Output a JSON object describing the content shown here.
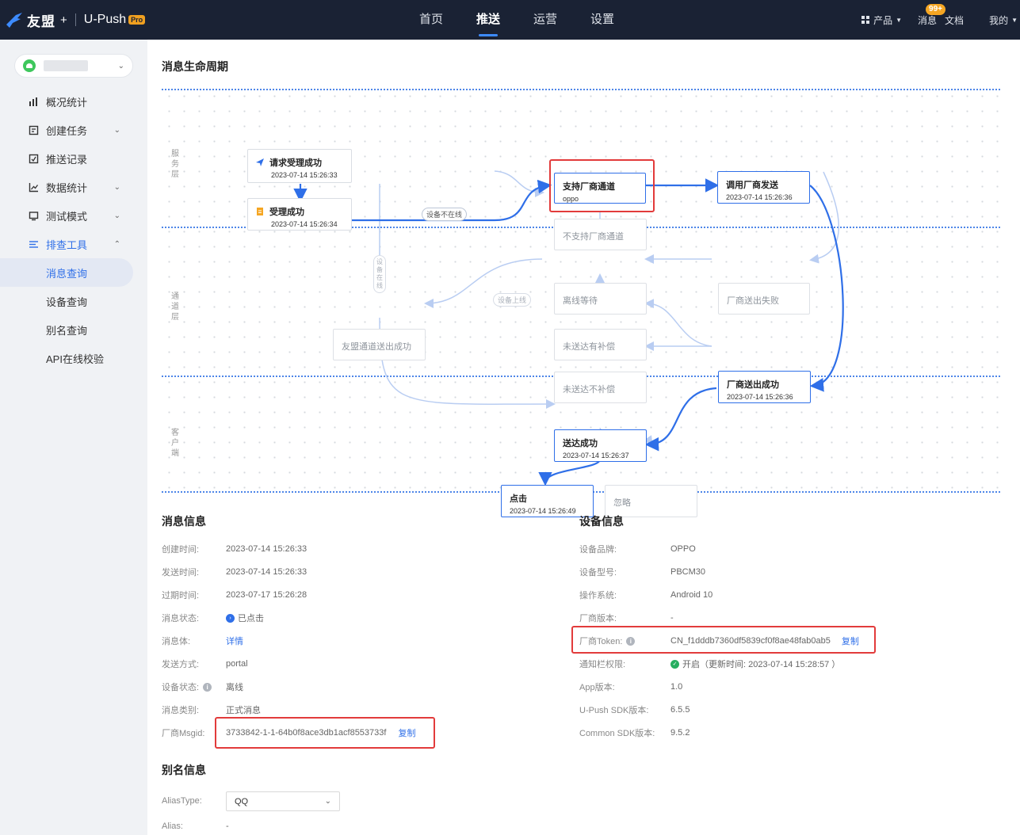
{
  "brand": {
    "name": "友盟",
    "plus": "+",
    "product": "U-Push",
    "badge": "Pro"
  },
  "nav": {
    "items": [
      "首页",
      "推送",
      "运营",
      "设置"
    ],
    "active_index": 1
  },
  "topright": {
    "products": "产品",
    "messages": "消息",
    "messages_badge": "99+",
    "docs": "文档",
    "mine": "我的"
  },
  "sidebar": {
    "menu": [
      {
        "label": "概况统计",
        "icon": "overview-icon"
      },
      {
        "label": "创建任务",
        "icon": "create-task-icon"
      },
      {
        "label": "推送记录",
        "icon": "push-record-icon"
      },
      {
        "label": "数据统计",
        "icon": "data-stats-icon"
      },
      {
        "label": "测试模式",
        "icon": "test-mode-icon"
      },
      {
        "label": "排查工具",
        "icon": "troubleshoot-icon"
      }
    ],
    "submenu": [
      "消息查询",
      "设备查询",
      "别名查询",
      "API在线校验"
    ],
    "active_sub": "消息查询"
  },
  "lifecycle": {
    "title": "消息生命周期",
    "layers": {
      "service": "服务层",
      "channel": "通道层",
      "client": "客户端"
    },
    "nodes": {
      "request_ok": {
        "title": "请求受理成功",
        "time": "2023-07-14 15:26:33"
      },
      "accept_ok": {
        "title": "受理成功",
        "time": "2023-07-14 15:26:34"
      },
      "vendor_support": {
        "title": "支持厂商通道",
        "sub": "oppo"
      },
      "vendor_call": {
        "title": "调用厂商发送",
        "time": "2023-07-14 15:26:36"
      },
      "vendor_unsupported": {
        "title": "不支持厂商通道"
      },
      "offline_wait": {
        "title": "离线等待"
      },
      "vendor_fail": {
        "title": "厂商送出失败"
      },
      "umeng_sent": {
        "title": "友盟通道送出成功"
      },
      "undelivered_comp": {
        "title": "未送达有补偿"
      },
      "undelivered_nocomp": {
        "title": "未送达不补偿"
      },
      "vendor_sent": {
        "title": "厂商送出成功",
        "time": "2023-07-14 15:26:36"
      },
      "delivered": {
        "title": "送达成功",
        "time": "2023-07-14 15:26:37"
      },
      "clicked": {
        "title": "点击",
        "time": "2023-07-14 15:26:49"
      },
      "ignored": {
        "title": "忽略"
      }
    },
    "edge_labels": {
      "device_offline": "设备不在线",
      "device_online": "设备在线",
      "device_online_up": "设备上线"
    }
  },
  "message_info": {
    "title": "消息信息",
    "rows": {
      "create_time": {
        "label": "创建时间:",
        "value": "2023-07-14 15:26:33"
      },
      "send_time": {
        "label": "发送时间:",
        "value": "2023-07-14 15:26:33"
      },
      "expire_time": {
        "label": "过期时间:",
        "value": "2023-07-17 15:26:28"
      },
      "status": {
        "label": "消息状态:",
        "value": "已点击"
      },
      "body": {
        "label": "消息体:",
        "value": "详情"
      },
      "method": {
        "label": "发送方式:",
        "value": "portal"
      },
      "device_status": {
        "label": "设备状态:",
        "value": "离线"
      },
      "category": {
        "label": "消息类别:",
        "value": "正式消息"
      },
      "msgid": {
        "label": "厂商Msgid:",
        "value": "3733842-1-1-64b0f8ace3db1acf8553733f",
        "action": "复制"
      }
    }
  },
  "device_info": {
    "title": "设备信息",
    "rows": {
      "brand": {
        "label": "设备品牌:",
        "value": "OPPO"
      },
      "model": {
        "label": "设备型号:",
        "value": "PBCM30"
      },
      "os": {
        "label": "操作系统:",
        "value": "Android 10"
      },
      "vendor_version": {
        "label": "厂商版本:",
        "value": "-"
      },
      "token": {
        "label": "厂商Token:",
        "value": "CN_f1dddb7360df5839cf0f8ae48fab0ab5",
        "action": "复制"
      },
      "notify_perm": {
        "label": "通知栏权限:",
        "value": "开启（更新时间: 2023-07-14 15:28:57 ）"
      },
      "app_version": {
        "label": "App版本:",
        "value": "1.0"
      },
      "upush_sdk": {
        "label": "U-Push SDK版本:",
        "value": "6.5.5"
      },
      "common_sdk": {
        "label": "Common SDK版本:",
        "value": "9.5.2"
      }
    }
  },
  "alias_info": {
    "title": "别名信息",
    "alias_type": {
      "label": "AliasType:",
      "value": "QQ"
    },
    "alias": {
      "label": "Alias:",
      "value": "-"
    }
  },
  "colors": {
    "accent": "#2f6fe8",
    "highlight": "#e23b3b",
    "topbar": "#1a2234",
    "success": "#27ae60"
  }
}
